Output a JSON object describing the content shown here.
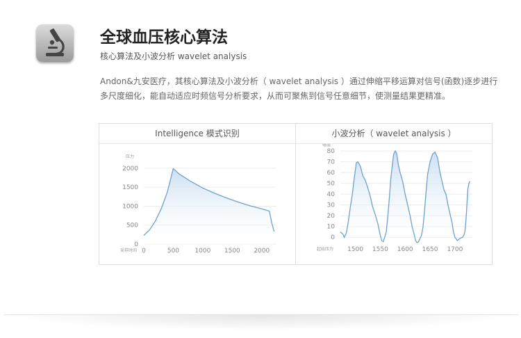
{
  "header": {
    "icon": "microscope-icon",
    "title": "全球血压核心算法",
    "subtitle": "核心算法及小波分析 wavelet analysis"
  },
  "paragraph": "Andon&九安医疗，其核心算法及小波分析（ wavelet analysis ）通过伸缩平移运算对信号(函数)逐步进行多尺度细化，能自动适应时频信号分析要求，从而可聚焦到信号任意细节，使测量结果更精准。",
  "panels": [
    {
      "title": "Intelligence 模式识别"
    },
    {
      "title": "小波分析（ wavelet analysis ）"
    }
  ],
  "colors": {
    "line": "#6fa0cc",
    "fill_top": "#c9def2"
  },
  "chart_data": [
    {
      "type": "area",
      "title": "Intelligence 模式识别",
      "xlabel": "采样时间",
      "ylabel": "压力",
      "xlim": [
        0,
        2250
      ],
      "ylim": [
        0,
        2200
      ],
      "xticks": [
        0,
        500,
        1000,
        1500,
        2000
      ],
      "yticks": [
        0,
        500,
        1000,
        1500,
        2000
      ],
      "grid": true,
      "x": [
        0,
        100,
        200,
        300,
        400,
        500,
        600,
        800,
        1000,
        1200,
        1400,
        1600,
        1800,
        2000,
        2130,
        2170,
        2210
      ],
      "y": [
        230,
        380,
        620,
        950,
        1380,
        1990,
        1850,
        1650,
        1480,
        1340,
        1220,
        1110,
        1010,
        930,
        870,
        560,
        330
      ]
    },
    {
      "type": "area",
      "title": "小波分析（ wavelet analysis ）",
      "xlabel": "起始压力",
      "ylabel": "幅值",
      "xlim": [
        1470,
        1735
      ],
      "ylim": [
        -5,
        82
      ],
      "xticks": [
        1500,
        1550,
        1600,
        1650,
        1700
      ],
      "yticks": [
        0,
        10,
        20,
        30,
        40,
        50,
        60,
        70,
        80
      ],
      "grid": true,
      "x": [
        1470,
        1475,
        1478,
        1482,
        1486,
        1490,
        1494,
        1497,
        1500,
        1502,
        1505,
        1510,
        1515,
        1520,
        1525,
        1530,
        1535,
        1540,
        1545,
        1550,
        1553,
        1556,
        1559,
        1562,
        1565,
        1568,
        1571,
        1574,
        1577,
        1580,
        1583,
        1586,
        1590,
        1595,
        1600,
        1605,
        1610,
        1614,
        1618,
        1621,
        1624,
        1627,
        1630,
        1633,
        1636,
        1639,
        1642,
        1645,
        1650,
        1655,
        1660,
        1665,
        1670,
        1674,
        1678,
        1682,
        1686,
        1690,
        1694,
        1697,
        1700,
        1705,
        1710,
        1715,
        1718,
        1720,
        1722,
        1724,
        1726,
        1728,
        1730
      ],
      "y": [
        5,
        3,
        0,
        4,
        15,
        28,
        40,
        52,
        62,
        69,
        70,
        66,
        57,
        53,
        46,
        38,
        28,
        21,
        13,
        2,
        -3,
        -4,
        0,
        5,
        18,
        35,
        53,
        66,
        77,
        80,
        78,
        68,
        60,
        52,
        40,
        30,
        20,
        10,
        3,
        -3,
        -5,
        -4,
        -1,
        2,
        10,
        25,
        42,
        58,
        70,
        77,
        79,
        74,
        60,
        52,
        44,
        40,
        30,
        22,
        14,
        5,
        0,
        -3,
        -1,
        0,
        2,
        5,
        15,
        30,
        45,
        50,
        52
      ]
    }
  ]
}
